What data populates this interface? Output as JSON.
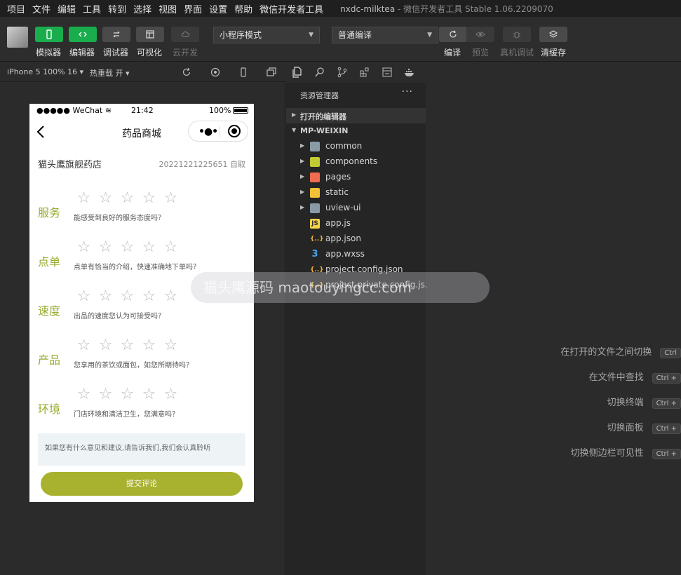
{
  "menu": [
    "项目",
    "文件",
    "编辑",
    "工具",
    "转到",
    "选择",
    "视图",
    "界面",
    "设置",
    "帮助",
    "微信开发者工具"
  ],
  "window_title": {
    "project": "nxdc-milktea",
    "app": " - 微信开发者工具 Stable 1.06.2209070"
  },
  "toolbar": {
    "simulator": "模拟器",
    "editor": "编辑器",
    "debugger": "调试器",
    "visual": "可视化",
    "cloud": "云开发",
    "mode_select": "小程序模式",
    "compile_select": "普通编译",
    "compile": "编译",
    "preview": "预览",
    "remote_debug": "真机调试",
    "clear_cache": "清缓存"
  },
  "subbar": {
    "device": "iPhone 5 100% 16 ▾",
    "hot_reload": "热重载 开 ▾"
  },
  "phone": {
    "status_left": "●●●●● WeChat",
    "status_time": "21:42",
    "status_battery": "100%",
    "nav_title": "药品商城",
    "shop_name": "猫头鹰旗舰药店",
    "order_info": "20221221225651  自取",
    "ratings": [
      {
        "label": "服务",
        "question": "能感受到良好的服务态度吗？"
      },
      {
        "label": "点单",
        "question": "点单有恰当的介绍，快速准确地下单吗？"
      },
      {
        "label": "速度",
        "question": "出品的速度您认为可接受吗？"
      },
      {
        "label": "产品",
        "question": "您享用的茶饮或面包，如您所期待吗？"
      },
      {
        "label": "环境",
        "question": "门店环境和清洁卫生，您满意吗？"
      }
    ],
    "feedback_placeholder": "如果您有什么意见和建议,请告诉我们,我们会认真聆听",
    "submit": "提交评论"
  },
  "explorer": {
    "title": "资源管理器",
    "more": "···",
    "open_editors": "打开的编辑器",
    "root": "MP-WEIXIN",
    "items": [
      {
        "name": "common",
        "kind": "folder",
        "color": "#8a9ba8"
      },
      {
        "name": "components",
        "kind": "folder",
        "color": "#c0ca33"
      },
      {
        "name": "pages",
        "kind": "folder",
        "color": "#ef6c50"
      },
      {
        "name": "static",
        "kind": "folder",
        "color": "#f2c037"
      },
      {
        "name": "uview-ui",
        "kind": "folder",
        "color": "#8a9ba8"
      },
      {
        "name": "app.js",
        "kind": "js",
        "color": "#f5d547"
      },
      {
        "name": "app.json",
        "kind": "json",
        "color": "#f5b335"
      },
      {
        "name": "app.wxss",
        "kind": "wxss",
        "color": "#4aa3ef"
      },
      {
        "name": "project.config.json",
        "kind": "json",
        "color": "#f5b335"
      },
      {
        "name": "project.private.config.js...",
        "kind": "json",
        "color": "#f5b335"
      }
    ]
  },
  "shortcuts": [
    {
      "label": "在打开的文件之间切换",
      "key": "Ctrl"
    },
    {
      "label": "在文件中查找",
      "key": "Ctrl +"
    },
    {
      "label": "切换终端",
      "key": "Ctrl +"
    },
    {
      "label": "切换面板",
      "key": "Ctrl +"
    },
    {
      "label": "切换侧边栏可见性",
      "key": "Ctrl +"
    }
  ],
  "watermark": "猫头鹰源码 maotouyingcc.com"
}
